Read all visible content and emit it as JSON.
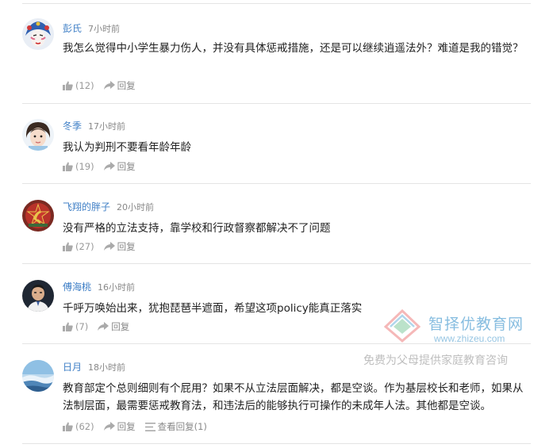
{
  "comments": [
    {
      "username": "彭氏",
      "time": "7小时前",
      "text": "我怎么觉得中小学生暴力伤人，并没有具体惩戒措施，还是可以继续逍遥法外？难道是我的错觉？",
      "likes": "(12)",
      "reply": "回复"
    },
    {
      "username": "冬季",
      "time": "17小时前",
      "text": "我认为判刑不要看年龄年龄",
      "likes": "(19)",
      "reply": "回复"
    },
    {
      "username": "飞翔的胖子",
      "time": "20小时前",
      "text": "没有严格的立法支持，靠学校和行政督察都解决不了问题",
      "likes": "(27)",
      "reply": "回复"
    },
    {
      "username": "傅海桃",
      "time": "16小时前",
      "text": "千呼万唤始出来，犹抱琵琶半遮面，希望这项policy能真正落实",
      "likes": "(7)",
      "reply": "回复"
    },
    {
      "username": "日月",
      "time": "18小时前",
      "text": "教育部定个总则细则有个屁用？如果不从立法层面解决，都是空谈。作为基层校长和老师，如果从法制层面，最需要惩戒教育法，和违法后的能够执行可操作的未成年人法。其他都是空谈。",
      "likes": "(62)",
      "reply": "回复",
      "view_replies": "查看回复(1)"
    }
  ],
  "icons": {
    "like": "thumbs-up-icon",
    "reply": "reply-arrow-icon",
    "view_replies": "list-icon"
  },
  "colors": {
    "username": "#3f7fc6",
    "meta_gray": "#888888",
    "divider": "#e4e4e4"
  },
  "watermark": {
    "title": "智择优教育网",
    "url": "www.zhizeu.com",
    "slogan": "免费为父母提供家庭教育咨询"
  }
}
